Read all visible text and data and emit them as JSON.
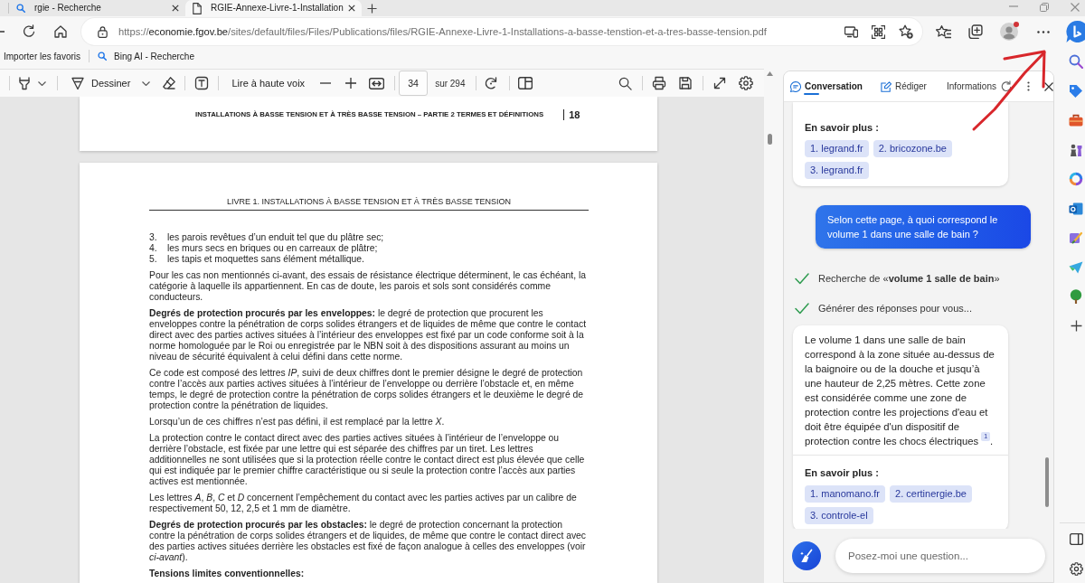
{
  "browser": {
    "tabs": [
      {
        "title": "rgie - Recherche",
        "kind": "search",
        "selected": false
      },
      {
        "title": "RGIE-Annexe-Livre-1-Installation",
        "kind": "document",
        "selected": true
      }
    ],
    "address_bar": {
      "scheme": "https://",
      "host": "economie.fgov.be",
      "path": "/sites/default/files/Files/Publications/files/RGIE-Annexe-Livre-1-Installations-a-basse-tenstion-et-a-tres-basse-tension.pdf"
    },
    "profile": {
      "notification": true
    },
    "favorites_bar": [
      {
        "label": "Importer les favoris",
        "kind": "plain"
      },
      {
        "label": "Bing AI - Recherche",
        "kind": "search"
      }
    ]
  },
  "pdf_viewer": {
    "toolbar": {
      "draw_label": "Dessiner",
      "read_aloud_label": "Lire à haute voix",
      "page_number": "34",
      "page_total": "sur 294"
    },
    "previous_page": {
      "running_header": "INSTALLATIONS À BASSE TENSION ET À TRÈS BASSE TENSION – PARTIE 2 TERMES ET DÉFINITIONS",
      "page_number": "18"
    },
    "page": {
      "title": "LIVRE 1. INSTALLATIONS À BASSE TENSION ET À TRÈS BASSE TENSION",
      "blocks": [
        {
          "kind": "list_item",
          "number": "3.",
          "text": "les parois revêtues d’un enduit tel que du plâtre sec;"
        },
        {
          "kind": "list_item",
          "number": "4.",
          "text": "les murs secs en briques ou en carreaux de plâtre;"
        },
        {
          "kind": "list_item",
          "number": "5.",
          "text": "les tapis et moquettes sans élément métallique."
        },
        {
          "kind": "paragraph",
          "text": "Pour les cas non mentionnés ci-avant, des essais de résistance électrique déterminent, le cas échéant, la catégorie à laquelle ils appartiennent. En cas de doute, les parois et sols sont considérés comme conducteurs."
        },
        {
          "kind": "paragraph",
          "text": "**Degrés de protection procurés par les enveloppes:** le degré de protection que procurent les enveloppes contre la pénétration de corps solides étrangers et de liquides de même que contre le contact direct avec des parties actives situées à l’intérieur des enveloppes est fixé par un code conforme soit à la norme homologuée par le Roi ou enregistrée par le NBN soit à des dispositions assurant au moins un niveau de sécurité équivalent à celui défini dans cette norme."
        },
        {
          "kind": "paragraph",
          "text": "Ce code est composé des lettres *IP*, suivi de deux chiffres dont le premier désigne le degré de protection contre l’accès aux parties actives situées à l’intérieur de l’enveloppe ou derrière l’obstacle et, en même temps, le degré de protection contre la pénétration de corps solides étrangers et le deuxième le degré de protection contre la pénétration de liquides."
        },
        {
          "kind": "paragraph",
          "text": "Lorsqu’un de ces chiffres n’est pas défini, il est remplacé par la lettre *X*."
        },
        {
          "kind": "paragraph",
          "text": "La protection contre le contact direct avec des parties actives situées à l’intérieur de l’enveloppe ou derrière l’obstacle, est fixée par une lettre qui est séparée des chiffres par un tiret. Les lettres additionnelles ne sont utilisées que si la protection réelle contre le contact direct est plus élevée que celle qui est indiquée par le premier chiffre caractéristique ou si seule la protection contre l’accès aux parties actives est mentionnée."
        },
        {
          "kind": "paragraph",
          "text": "Les lettres *A*, *B*, *C* et *D* concernent l’empêchement du contact avec les parties actives par un calibre de respectivement 50, 12, 2,5 et 1 mm de diamètre."
        },
        {
          "kind": "paragraph",
          "text": "**Degrés de protection procurés par les obstacles:** le degré de protection concernant la protection contre la pénétration de corps solides étrangers et de liquides, de même que contre le contact direct avec des parties actives situées derrière les obstacles est fixé de façon analogue à celles des enveloppes (voir *ci-avant*)."
        },
        {
          "kind": "heading",
          "text": "Tensions limites conventionnelles:"
        }
      ]
    }
  },
  "sidebar": {
    "tabs": [
      {
        "label": "Conversation",
        "kind": "chat",
        "selected": true
      },
      {
        "label": "Rédiger",
        "kind": "compose",
        "selected": false
      },
      {
        "label": "Informations",
        "kind": "info",
        "selected": false
      }
    ],
    "messages": [
      {
        "kind": "sources",
        "heading": "En savoir plus :",
        "links": [
          "1. legrand.fr",
          "2. bricozone.be",
          "3. legrand.fr"
        ]
      },
      {
        "kind": "user",
        "text": "Selon cette page, à quoi correspond le volume 1 dans une salle de bain ?"
      },
      {
        "kind": "status",
        "text": "Recherche de «**volume 1 salle de bain**»",
        "done": true
      },
      {
        "kind": "status",
        "text": "Générer des réponses pour vous...",
        "done": true
      },
      {
        "kind": "answer",
        "text": "Le volume 1 dans une salle de bain correspond à la zone située au-dessus de la baignoire ou de la douche et jusqu’à une hauteur de 2,25 mètres. Cette zone est considérée comme une zone de protection contre les projections d'eau et doit être équipée d'un dispositif de protection contre les chocs électriques",
        "citation": "1",
        "ending": ".",
        "heading": "En savoir plus :",
        "links": [
          "1. manomano.fr",
          "2. certinergie.be",
          "3. controle-el"
        ]
      }
    ],
    "input": {
      "placeholder": "Posez-moi une question..."
    }
  }
}
